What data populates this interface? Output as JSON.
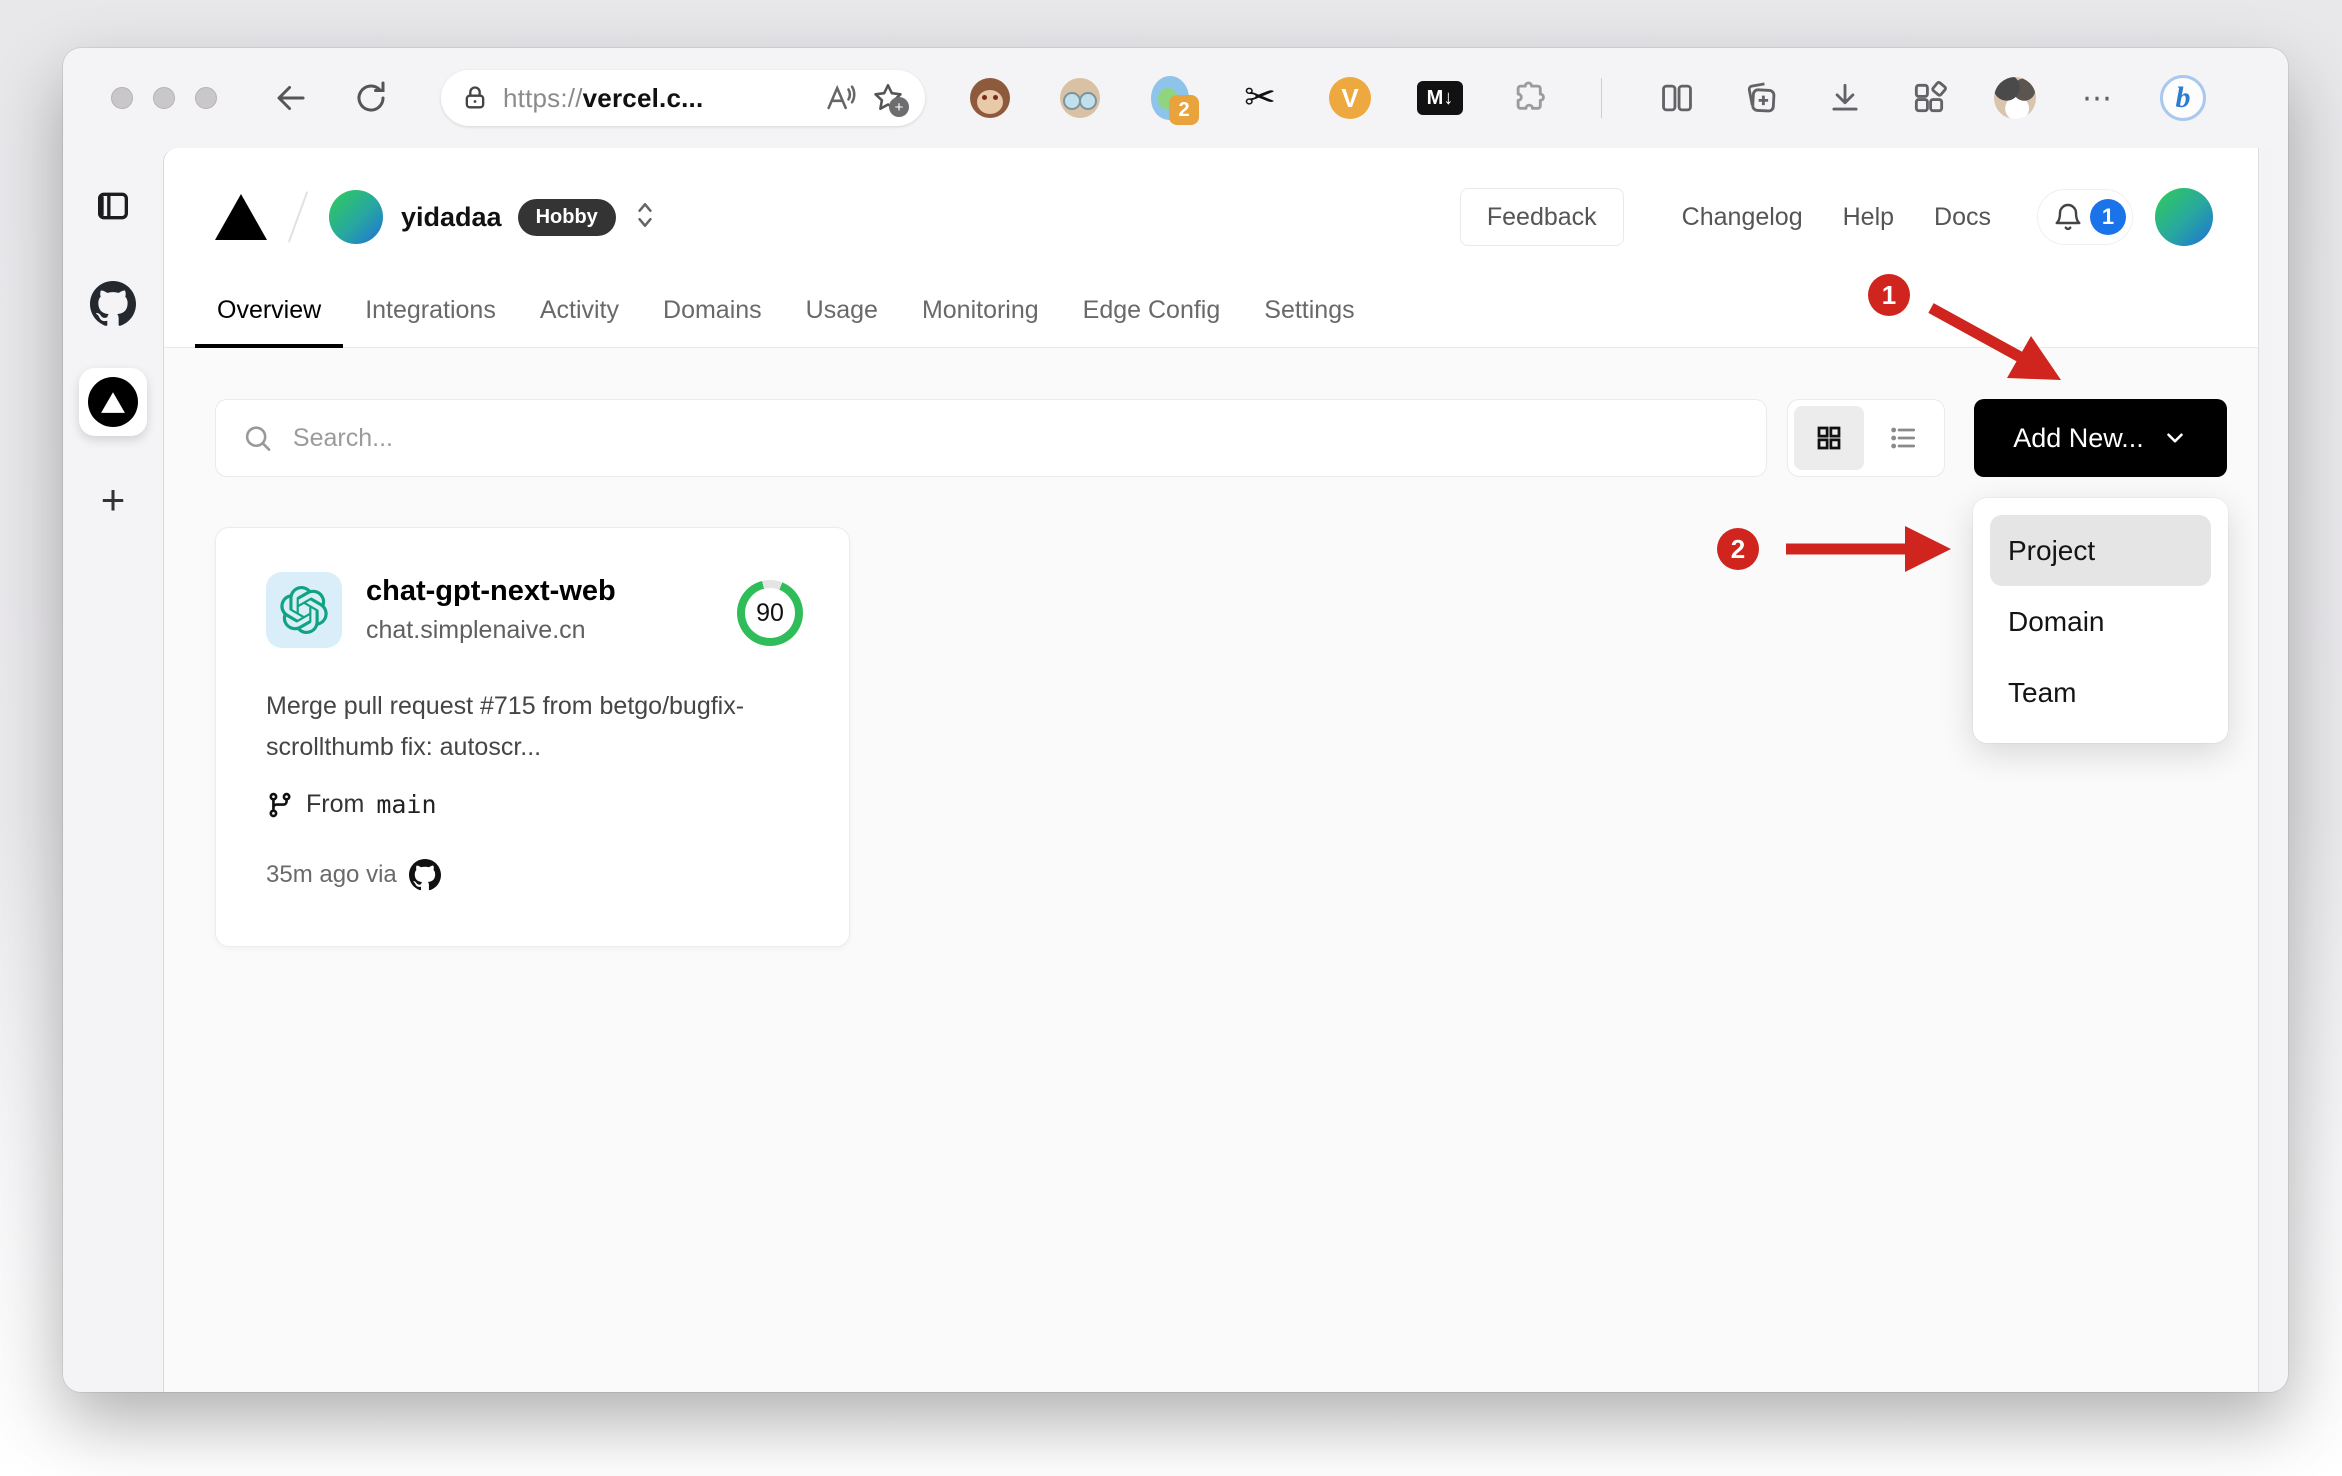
{
  "browser": {
    "url_scheme": "https://",
    "url_host_display": "vercel.c...",
    "extensions_badge_count": "2",
    "md_icon_label": "M↓",
    "v_icon_label": "V",
    "bing_icon_label": "b",
    "more_dots": "⋯",
    "scissors_glyph": "✂",
    "new_tab_glyph": "+"
  },
  "header": {
    "team_name": "yidadaa",
    "plan_badge": "Hobby",
    "feedback_label": "Feedback",
    "links": {
      "changelog": "Changelog",
      "help": "Help",
      "docs": "Docs"
    },
    "notification_count": "1"
  },
  "tabs": [
    {
      "label": "Overview",
      "active": true
    },
    {
      "label": "Integrations",
      "active": false
    },
    {
      "label": "Activity",
      "active": false
    },
    {
      "label": "Domains",
      "active": false
    },
    {
      "label": "Usage",
      "active": false
    },
    {
      "label": "Monitoring",
      "active": false
    },
    {
      "label": "Edge Config",
      "active": false
    },
    {
      "label": "Settings",
      "active": false
    }
  ],
  "controls": {
    "search_placeholder": "Search...",
    "add_new_label": "Add New..."
  },
  "project_card": {
    "name": "chat-gpt-next-web",
    "domain": "chat.simplenaive.cn",
    "score": "90",
    "commit_message": "Merge pull request #715 from betgo/bugfix-scrollthumb fix: autoscr...",
    "branch_prefix": "From",
    "branch_name": "main",
    "deployed_text": "35m ago via"
  },
  "add_new_menu": {
    "items": [
      {
        "label": "Project",
        "highlighted": true
      },
      {
        "label": "Domain",
        "highlighted": false
      },
      {
        "label": "Team",
        "highlighted": false
      }
    ]
  },
  "annotations": {
    "step_1": "1",
    "step_2": "2"
  },
  "colors": {
    "annotation_red": "#d0241e",
    "score_green": "#2ebd59",
    "notification_blue": "#1a73e8",
    "openai_teal": "#10a37f",
    "add_new_black": "#000000",
    "page_body_gray": "#fafafa"
  }
}
